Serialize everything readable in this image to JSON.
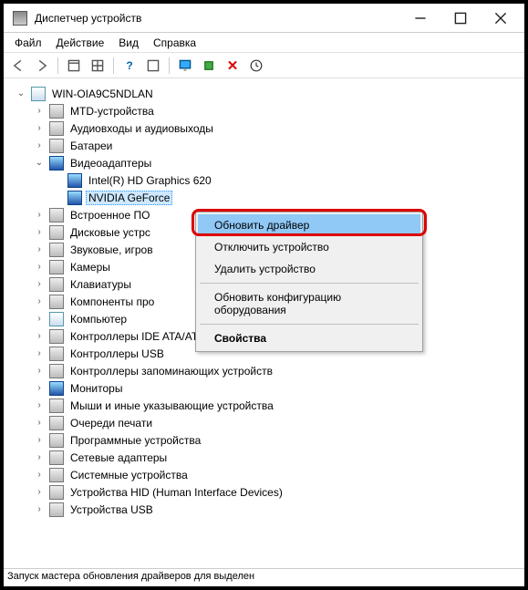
{
  "window": {
    "title": "Диспетчер устройств"
  },
  "menu": {
    "file": "Файл",
    "action": "Действие",
    "view": "Вид",
    "help": "Справка"
  },
  "tree": {
    "root": "WIN-OIA9C5NDLAN",
    "items": [
      "MTD-устройства",
      "Аудиовходы и аудиовыходы",
      "Батареи"
    ],
    "video": {
      "label": "Видеоадаптеры",
      "children": [
        "Intel(R) HD Graphics 620",
        "NVIDIA GeForce"
      ]
    },
    "rest": [
      "Встроенное ПО",
      "Дисковые устрс",
      "Звуковые, игров",
      "Камеры",
      "Клавиатуры",
      "Компоненты про",
      "Компьютер",
      "Контроллеры IDE ATA/ATAPI",
      "Контроллеры USB",
      "Контроллеры запоминающих устройств",
      "Мониторы",
      "Мыши и иные указывающие устройства",
      "Очереди печати",
      "Программные устройства",
      "Сетевые адаптеры",
      "Системные устройства",
      "Устройства HID (Human Interface Devices)",
      "Устройства USB"
    ]
  },
  "context": {
    "update": "Обновить драйвер",
    "disable": "Отключить устройство",
    "remove": "Удалить устройство",
    "scan": "Обновить конфигурацию оборудования",
    "props": "Свойства"
  },
  "status": "Запуск мастера обновления драйверов для выделен"
}
